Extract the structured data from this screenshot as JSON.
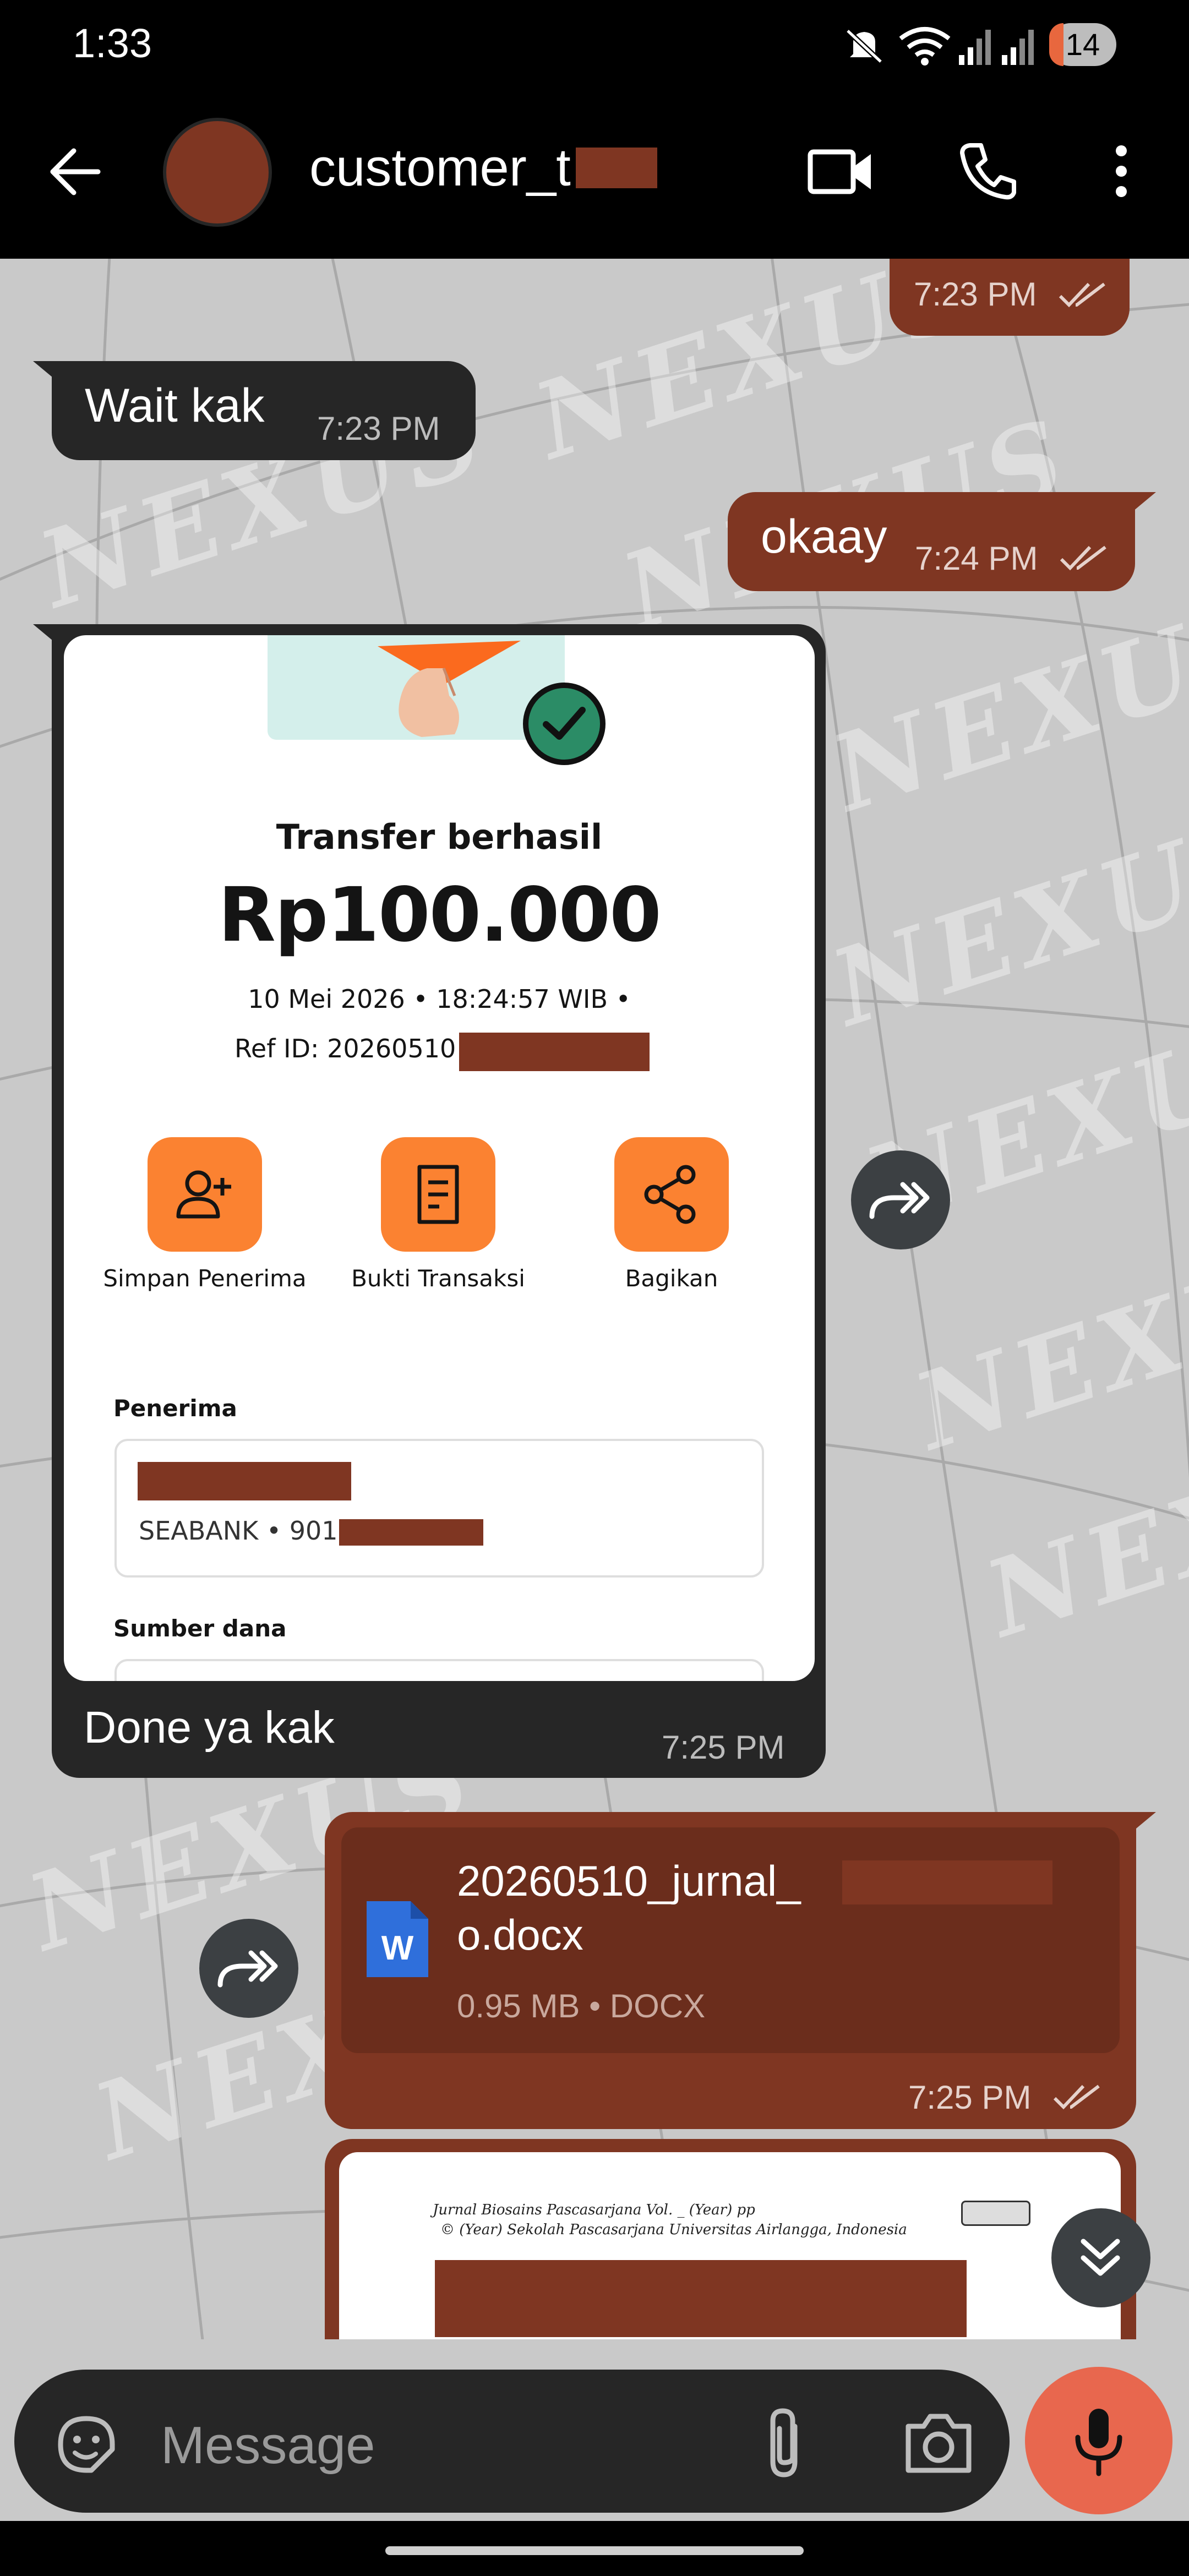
{
  "status_bar": {
    "time": "1:33",
    "battery": "14"
  },
  "header": {
    "contact_name": "customer_t"
  },
  "messages": [
    {
      "time": "7:23 PM"
    },
    {
      "text": "Wait kak",
      "time": "7:23 PM"
    },
    {
      "text": "okaay",
      "time": "7:24 PM"
    },
    {
      "caption": "Done ya kak",
      "time": "7:25 PM"
    },
    {
      "file_name_line1": "20260510_jurnal_",
      "file_name_line2": "o.docx",
      "file_meta": "0.95 MB • DOCX",
      "time": "7:25 PM"
    },
    {
      "doc_preview_line1": "Jurnal Biosains Pascasarjana Vol. _ (Year) pp",
      "doc_preview_line2": "© (Year) Sekolah Pascasarjana Universitas Airlangga, Indonesia"
    }
  ],
  "receipt": {
    "title": "Transfer berhasil",
    "amount": "Rp100.000",
    "datetime": "10 Mei 2026 • 18:24:57 WIB •",
    "ref_id": "Ref ID: 20260510",
    "actions": [
      "Simpan Penerima",
      "Bukti Transaksi",
      "Bagikan"
    ],
    "recipient_label": "Penerima",
    "recipient_bank": "SEABANK • 901",
    "source_label": "Sumber dana"
  },
  "watermark": "NEXUS",
  "input": {
    "placeholder": "Message"
  }
}
